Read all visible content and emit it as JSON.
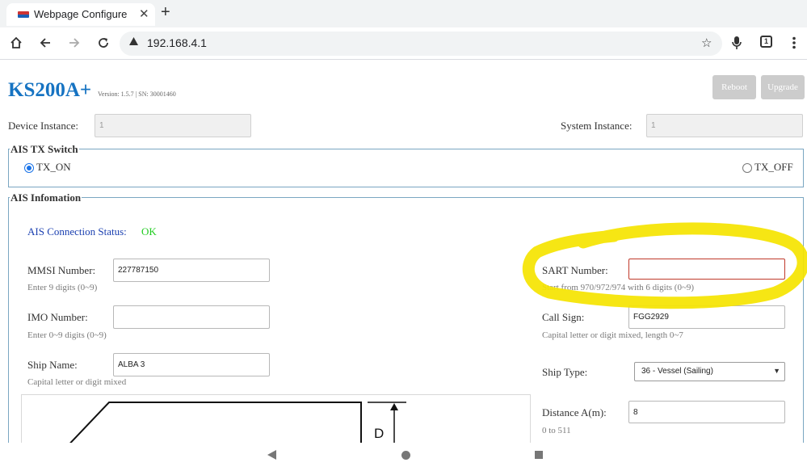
{
  "browser": {
    "tab_title": "Webpage Configure",
    "tab_close": "✕",
    "new_tab": "+",
    "url": "192.168.4.1",
    "tab_count": "1"
  },
  "icons": {
    "home": "home-icon",
    "back": "back-arrow-icon",
    "forward": "forward-arrow-icon",
    "reload": "reload-icon",
    "lock": "warning-triangle-icon",
    "star": "star-icon",
    "mic": "microphone-icon",
    "menu": "kebab-menu-icon"
  },
  "header": {
    "brand": "KS200A+",
    "version_text": "Version: 1.5.7 | SN: 30001460",
    "reboot_label": "Reboot",
    "upgrade_label": "Upgrade"
  },
  "instances": {
    "device_label": "Device Instance:",
    "device_value": "1",
    "system_label": "System Instance:",
    "system_value": "1"
  },
  "tx_switch": {
    "legend": "AIS TX Switch",
    "on_label": "TX_ON",
    "off_label": "TX_OFF",
    "selected": "TX_ON"
  },
  "ais_info": {
    "legend": "AIS Infomation",
    "status_label": "AIS Connection Status:",
    "status_value": "OK",
    "status_color": "#22cc22",
    "mmsi_label": "MMSI Number:",
    "mmsi_value": "227787150",
    "mmsi_hint": "Enter 9 digits (0~9)",
    "imo_label": "IMO Number:",
    "imo_value": "",
    "imo_hint": "Enter 0~9 digits (0~9)",
    "ship_name_label": "Ship Name:",
    "ship_name_value": "ALBA 3",
    "ship_name_hint": "Capital letter or digit mixed",
    "sart_label": "SART Number:",
    "sart_value": "",
    "sart_hint": "Start from 970/972/974 with 6 digits (0~9)",
    "call_sign_label": "Call Sign:",
    "call_sign_value": "FGG2929",
    "call_sign_hint": "Capital letter or digit mixed, length 0~7",
    "ship_type_label": "Ship Type:",
    "ship_type_value": "36 - Vessel (Sailing)",
    "distance_a_label": "Distance A(m):",
    "distance_a_value": "8",
    "distance_a_hint": "0 to 511",
    "diagram_label": "D"
  },
  "colors": {
    "brand": "#1673c2",
    "fieldset_border": "#7aa6c2",
    "highlight": "#f5e400",
    "status_blue": "#1a3fb0"
  }
}
